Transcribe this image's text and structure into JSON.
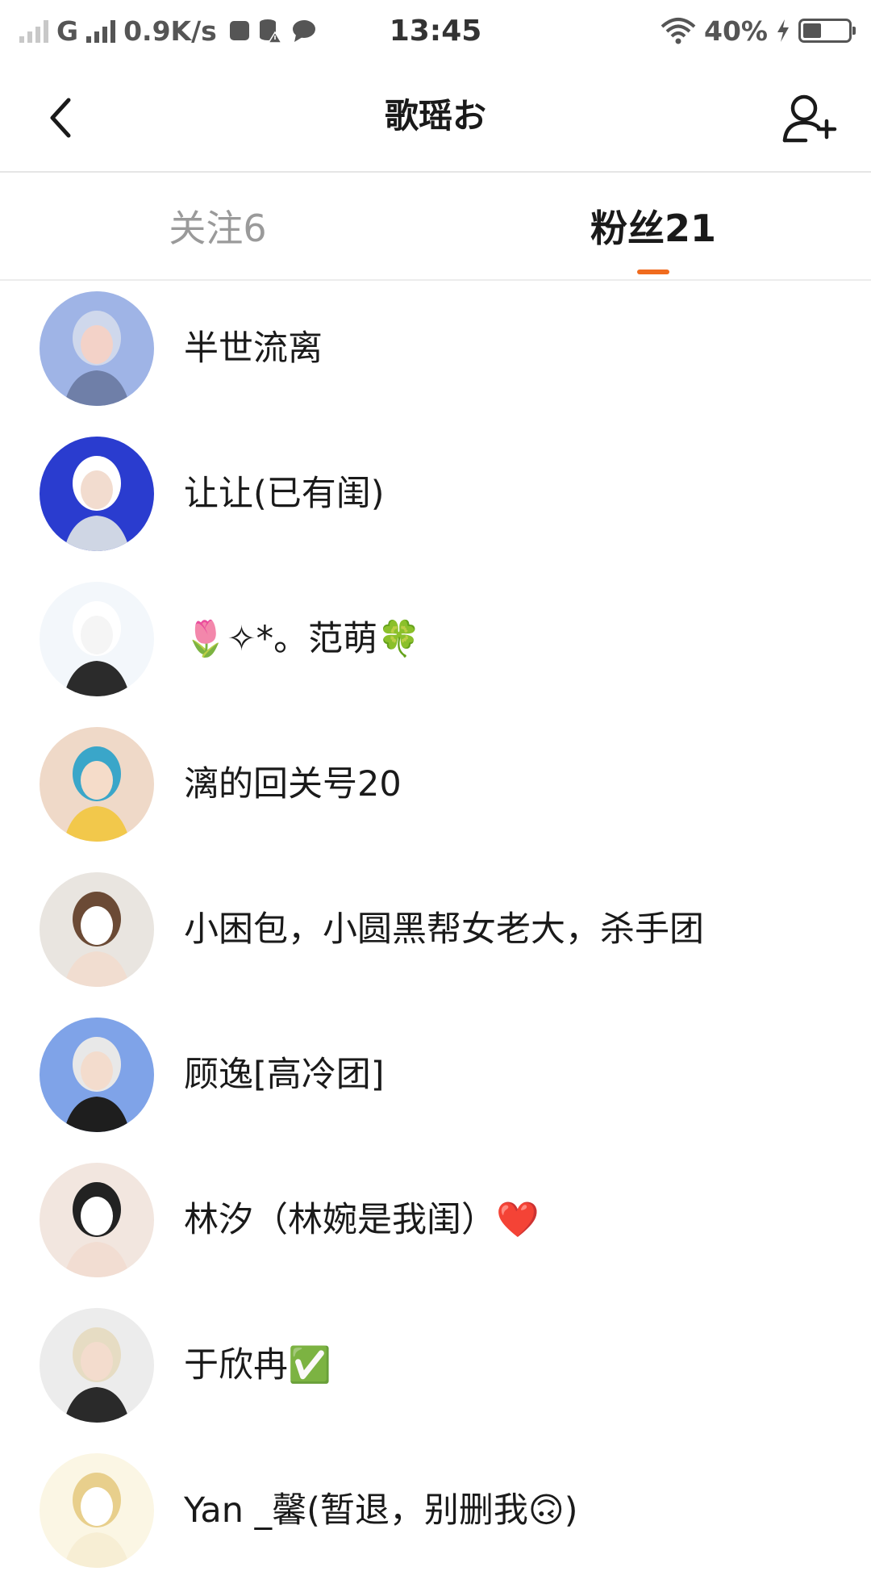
{
  "status_bar": {
    "network": "G",
    "speed": "0.9K/s",
    "time": "13:45",
    "battery": "40%",
    "battery_level": 0.4
  },
  "header": {
    "title": "歌瑶お"
  },
  "tabs": [
    {
      "label": "关注6",
      "active": false
    },
    {
      "label": "粉丝21",
      "active": true
    }
  ],
  "followers": [
    {
      "name": "半世流离",
      "avatar_bg": "#9fb4e6"
    },
    {
      "name": "让让(已有闺)",
      "avatar_bg": "#2a3ccf"
    },
    {
      "name": "🌷✧*。范萌🍀",
      "avatar_bg": "#f3f7fb"
    },
    {
      "name": "漓的回关号20",
      "avatar_bg": "#efd9c8"
    },
    {
      "name": "小困包，小圆黑帮女老大，杀手团",
      "avatar_bg": "#e9e5e0"
    },
    {
      "name": "顾逸[高冷团]",
      "avatar_bg": "#7fa3e8"
    },
    {
      "name": "林汐（林婉是我闺）❤️",
      "avatar_bg": "#f2e6df"
    },
    {
      "name": "于欣冉✅",
      "avatar_bg": "#ececec"
    },
    {
      "name": "Yan _馨(暂退，别删我🙃)",
      "avatar_bg": "#fbf6e4"
    }
  ]
}
